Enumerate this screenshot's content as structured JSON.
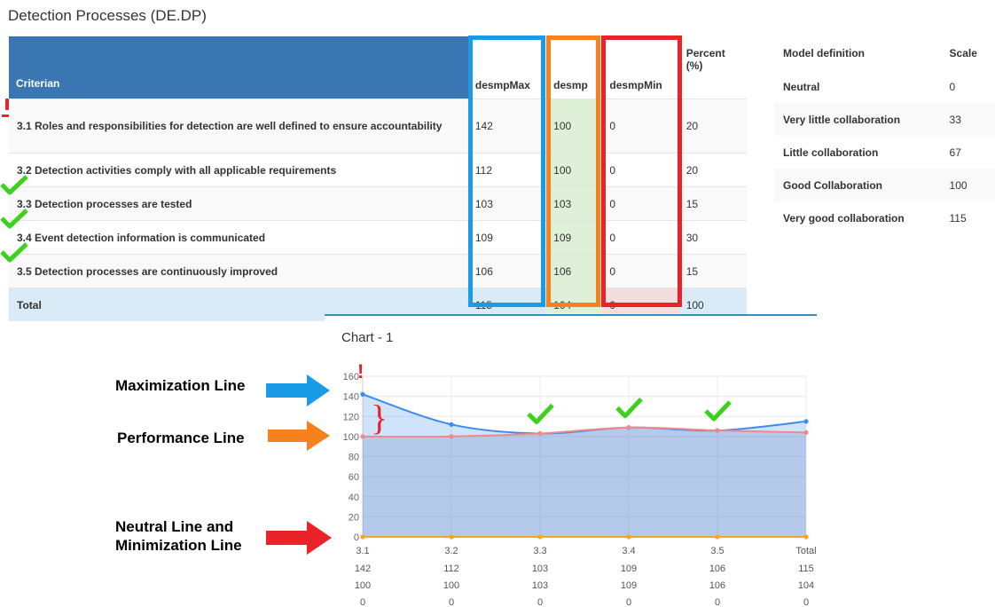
{
  "page": {
    "title": "Detection Processes (DE.DP)"
  },
  "main_table": {
    "headers": {
      "criterion": "Criterian",
      "max": "desmpMax",
      "perf": "desmp",
      "min": "desmpMin",
      "pct1": "Percent",
      "pct2": "(%)"
    },
    "rows": [
      {
        "criterion": "3.1 Roles and responsibilities for detection are well defined to ensure accountability",
        "max": "142",
        "perf": "100",
        "min": "0",
        "pct": "20"
      },
      {
        "criterion": "3.2 Detection activities comply with all applicable requirements",
        "max": "112",
        "perf": "100",
        "min": "0",
        "pct": "20"
      },
      {
        "criterion": "3.3 Detection processes are tested",
        "max": "103",
        "perf": "103",
        "min": "0",
        "pct": "15"
      },
      {
        "criterion": "3.4 Event detection information is communicated",
        "max": "109",
        "perf": "109",
        "min": "0",
        "pct": "30"
      },
      {
        "criterion": "3.5 Detection processes are continuously improved",
        "max": "106",
        "perf": "106",
        "min": "0",
        "pct": "15"
      },
      {
        "criterion": "Total",
        "max": "115",
        "perf": "104",
        "min": "0",
        "pct": "100"
      }
    ]
  },
  "model_table": {
    "headers": {
      "definition": "Model definition",
      "scale": "Scale"
    },
    "rows": [
      {
        "definition": "Neutral",
        "scale": "0"
      },
      {
        "definition": "Very little collaboration",
        "scale": "33"
      },
      {
        "definition": "Little collaboration",
        "scale": "67"
      },
      {
        "definition": "Good Collaboration",
        "scale": "100"
      },
      {
        "definition": "Very good collaboration",
        "scale": "115"
      }
    ]
  },
  "annotations": {
    "max_label": "Maximization Line",
    "perf_label": "Performance Line",
    "min_label_1": "Neutral Line and",
    "min_label_2": "Minimization Line",
    "exclaim": "!",
    "brace": "}"
  },
  "colors": {
    "header_blue": "#3a77b2",
    "box_blue": "#1a9be6",
    "box_orange": "#f5821f",
    "box_red": "#e8232a",
    "check_green": "#3cd11c",
    "max_line": "#3d8bec",
    "perf_line": "#ef8a8a",
    "min_line": "#f5a623"
  },
  "chart_data": {
    "title": "Chart - 1",
    "type": "area",
    "categories": [
      "3.1",
      "3.2",
      "3.3",
      "3.4",
      "3.5",
      "Total"
    ],
    "series": [
      {
        "name": "desmpMax",
        "values": [
          142,
          112,
          103,
          109,
          106,
          115
        ]
      },
      {
        "name": "desmp",
        "values": [
          100,
          100,
          103,
          109,
          106,
          104
        ]
      },
      {
        "name": "desmpMin",
        "values": [
          0,
          0,
          0,
          0,
          0,
          0
        ]
      }
    ],
    "ylim": [
      0,
      160
    ],
    "yticks": [
      "0",
      "20",
      "40",
      "60",
      "80",
      "100",
      "120",
      "140",
      "160"
    ],
    "grid": true
  }
}
